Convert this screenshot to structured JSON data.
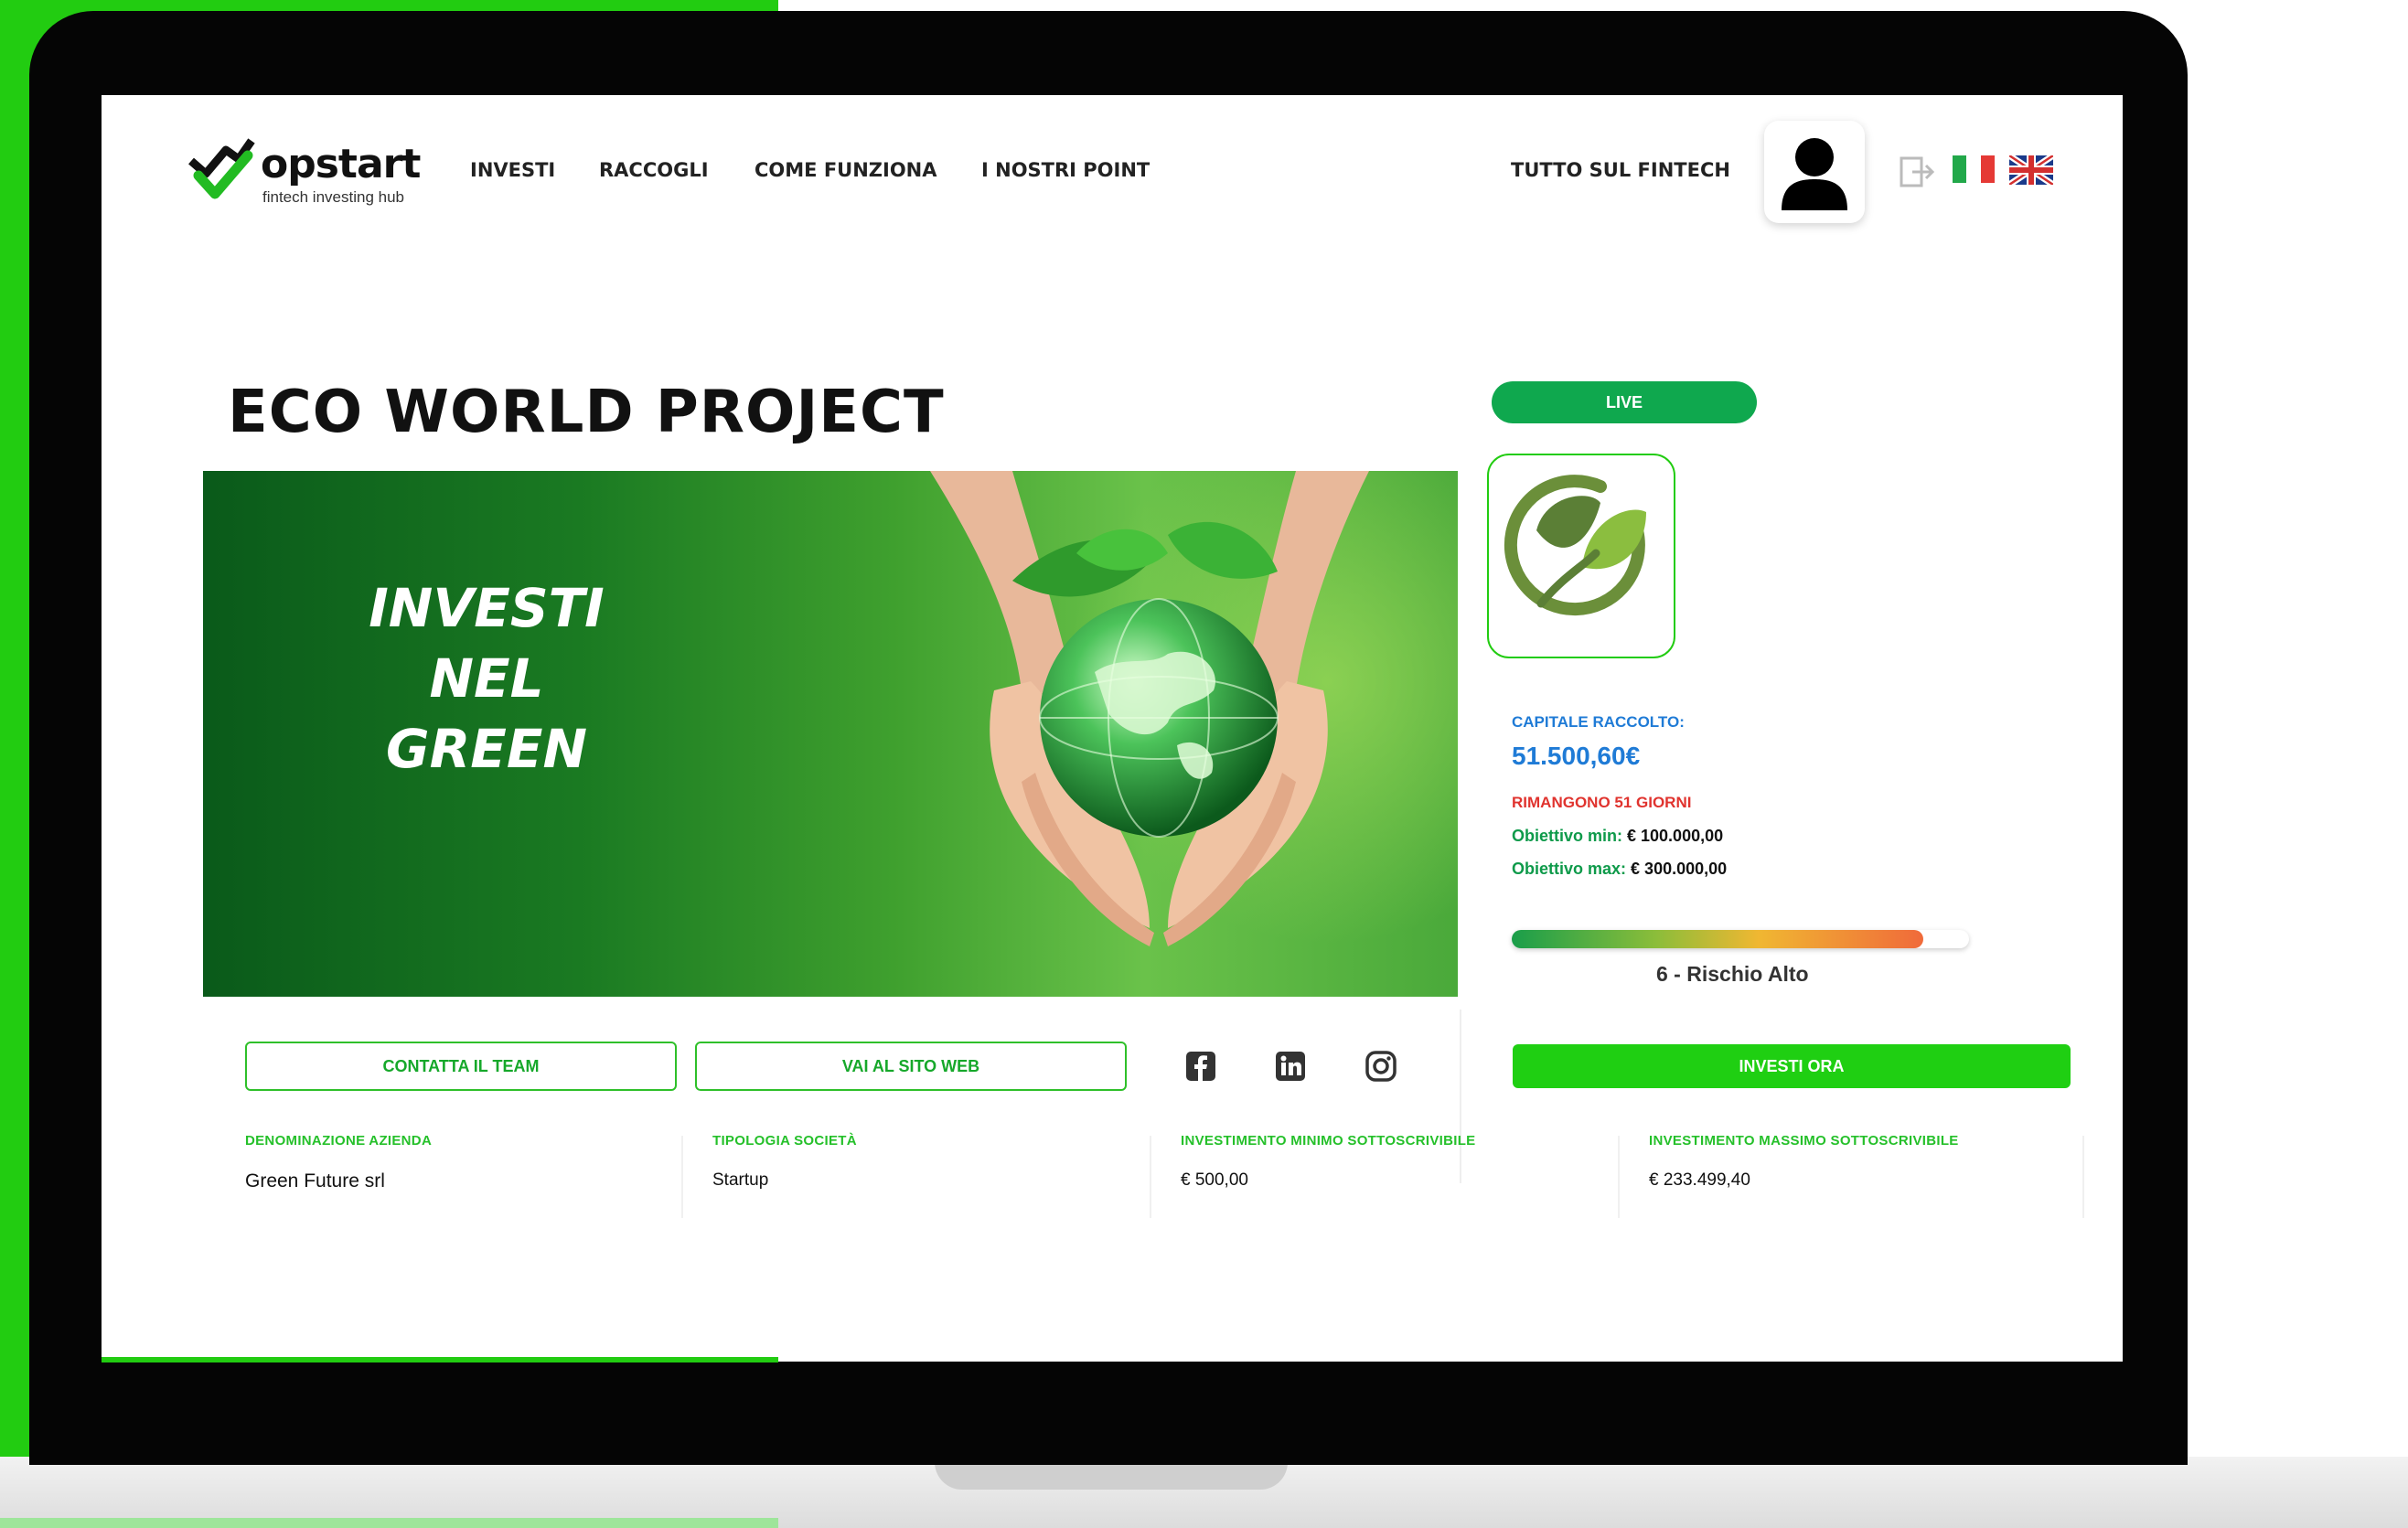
{
  "brand": {
    "name": "opstart",
    "tagline": "fintech investing hub",
    "accent_color": "#22cc11"
  },
  "nav": {
    "items": [
      {
        "label": "INVESTI"
      },
      {
        "label": "RACCOGLI"
      },
      {
        "label": "COME FUNZIONA"
      },
      {
        "label": "I NOSTRI POINT"
      }
    ],
    "right_link": "TUTTO SUL FINTECH",
    "icons": [
      "user-icon",
      "logout-icon",
      "flag-italy-icon",
      "flag-uk-icon"
    ]
  },
  "project": {
    "title": "ECO WORLD PROJECT",
    "hero_lines": [
      "INVESTI",
      "NEL",
      "GREEN"
    ]
  },
  "campaign": {
    "status": "LIVE",
    "raised_label": "CAPITALE RACCOLTO:",
    "raised_value": "51.500,60€",
    "days_left": "RIMANGONO 51 GIORNI",
    "goal_min_label": "Obiettivo min:",
    "goal_min_value": "€ 100.000,00",
    "goal_max_label": "Obiettivo max:",
    "goal_max_value": "€ 300.000,00",
    "risk_level": 6,
    "risk_fraction": 0.9,
    "risk_label": "6 - Rischio Alto",
    "cta": "INVESTI ORA"
  },
  "actions": {
    "contact": "CONTATTA IL TEAM",
    "website": "VAI AL SITO WEB",
    "social": [
      "facebook-icon",
      "linkedin-icon",
      "instagram-icon"
    ]
  },
  "info": [
    {
      "label": "DENOMINAZIONE AZIENDA",
      "value": "Green Future srl"
    },
    {
      "label": "TIPOLOGIA SOCIETÀ",
      "value": "Startup"
    },
    {
      "label": "INVESTIMENTO MINIMO SOTTOSCRIVIBILE",
      "value": "€ 500,00"
    },
    {
      "label": "INVESTIMENTO MASSIMO SOTTOSCRIVIBILE",
      "value": "€ 233.499,40"
    }
  ]
}
